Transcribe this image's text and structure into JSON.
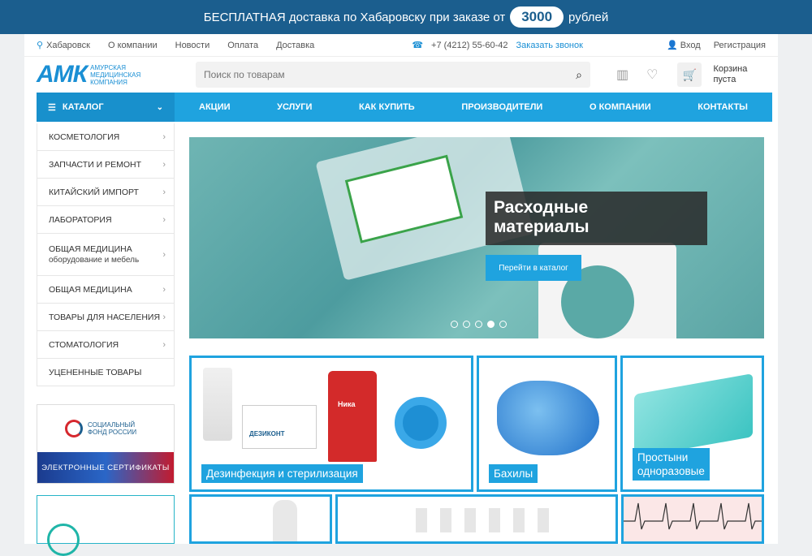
{
  "promo": {
    "prefix": "БЕСПЛАТНАЯ доставка по Хабаровску при заказе от",
    "amount": "3000",
    "suffix": "рублей"
  },
  "topbar": {
    "city": "Хабаровск",
    "links": [
      "О компании",
      "Новости",
      "Оплата",
      "Доставка"
    ],
    "phone": "+7 (4212) 55-60-42",
    "callback": "Заказать звонок",
    "login": "Вход",
    "register": "Регистрация"
  },
  "logo": {
    "mark": "АМК",
    "line1": "Амурская",
    "line2": "Медицинская",
    "line3": "Компания"
  },
  "search": {
    "placeholder": "Поиск по товарам"
  },
  "cart": {
    "line1": "Корзина",
    "line2": "пуста"
  },
  "nav": {
    "catalog": "КАТАЛОГ",
    "items": [
      "АКЦИИ",
      "УСЛУГИ",
      "КАК КУПИТЬ",
      "ПРОИЗВОДИТЕЛИ",
      "О КОМПАНИИ",
      "КОНТАКТЫ"
    ]
  },
  "sidebar": {
    "items": [
      {
        "label": "КОСМЕТОЛОГИЯ",
        "sub": ""
      },
      {
        "label": "ЗАПЧАСТИ И РЕМОНТ",
        "sub": ""
      },
      {
        "label": "КИТАЙСКИЙ ИМПОРТ",
        "sub": ""
      },
      {
        "label": "ЛАБОРАТОРИЯ",
        "sub": ""
      },
      {
        "label": "ОБЩАЯ МЕДИЦИНА",
        "sub": "оборудование и мебель"
      },
      {
        "label": "ОБЩАЯ МЕДИЦИНА",
        "sub": ""
      },
      {
        "label": "ТОВАРЫ ДЛЯ НАСЕЛЕНИЯ",
        "sub": ""
      },
      {
        "label": "СТОМАТОЛОГИЯ",
        "sub": ""
      },
      {
        "label": "УЦЕНЕННЫЕ ТОВАРЫ",
        "sub": ""
      }
    ]
  },
  "banner_sf": {
    "line1": "СОЦИАЛЬНЫЙ",
    "line2": "ФОНД РОССИИ",
    "caption": "ЭЛЕКТРОННЫЕ СЕРТИФИКАТЫ"
  },
  "slider": {
    "title_line1": "Расходные",
    "title_line2": "материалы",
    "button": "Перейти в каталог",
    "slides": 5,
    "active_slide": 4
  },
  "tiles": {
    "t1": "Дезинфекция и стерилизация",
    "t2": "Бахилы",
    "t3_line1": "Простыни",
    "t3_line2": "одноразовые"
  },
  "products": {
    "bottle_brand": "Ника",
    "box_brand": "ДЕЗИКОНТ"
  },
  "colors": {
    "accent": "#1fa3df",
    "promo_bg": "#1b5e8e",
    "brand": "#1a8fd4"
  }
}
